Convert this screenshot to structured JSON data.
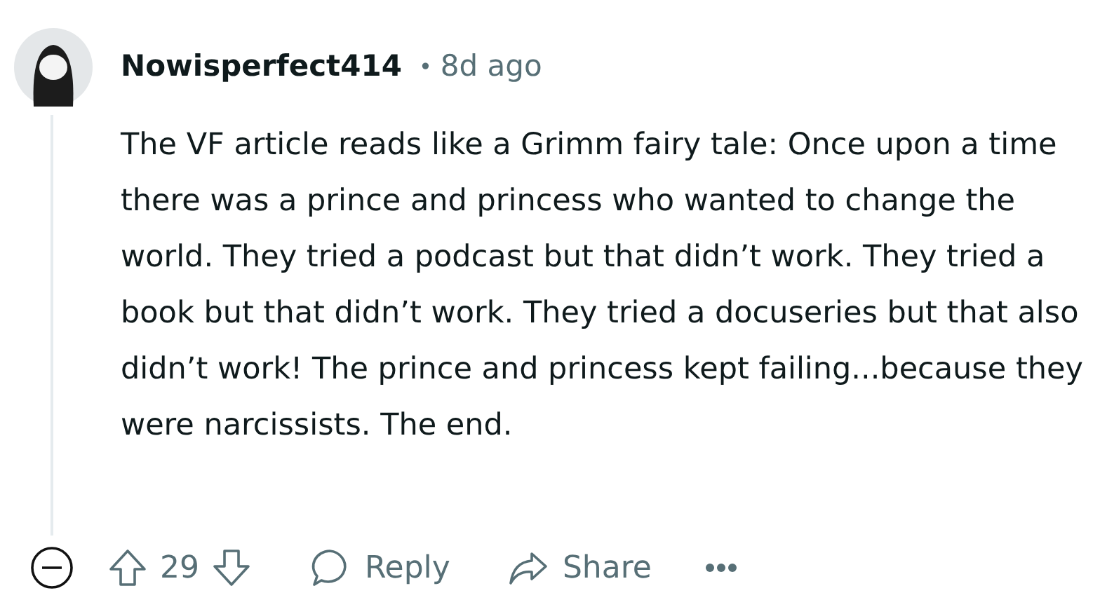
{
  "comment": {
    "author": "Nowisperfect414",
    "separator": "•",
    "age": "8d ago",
    "body": "The VF article reads like a Grimm fairy tale: Once upon a time there was a prince and princess who wanted to change the world. They tried a podcast but that didn’t work. They tried a book but that didn’t work. They tried a docuseries but that also didn’t work! The prince and princess kept failing...because they were narcissists. The end.",
    "score": "29",
    "actions": [
      {
        "kind": "reply",
        "label": "Reply"
      },
      {
        "kind": "share",
        "label": "Share"
      }
    ]
  }
}
